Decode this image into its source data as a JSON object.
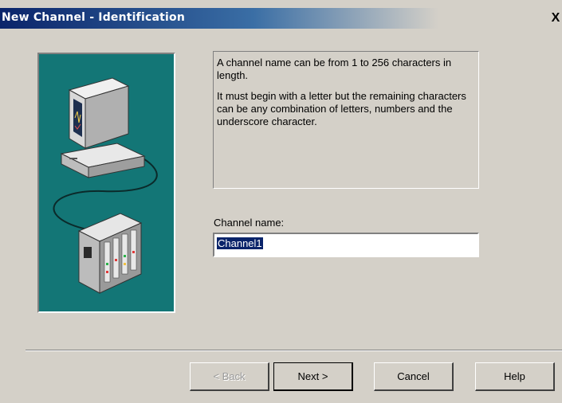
{
  "window": {
    "title": "New Channel - Identification",
    "close_label": "X"
  },
  "info": {
    "para1": "A channel name can be from 1 to 256 characters in length.",
    "para2": "It must begin with a letter but the remaining characters can be any combination of letters, numbers and the underscore character."
  },
  "form": {
    "channel_label": "Channel name:",
    "channel_value": "Channel1"
  },
  "buttons": {
    "back": "< Back",
    "next": "Next >",
    "cancel": "Cancel",
    "help": "Help"
  },
  "colors": {
    "dialog_bg": "#d4d0c8",
    "title_bg": "#0a246a",
    "illustration_bg": "#137676"
  },
  "icons": {
    "illustration": "computer-and-plc-icon"
  }
}
